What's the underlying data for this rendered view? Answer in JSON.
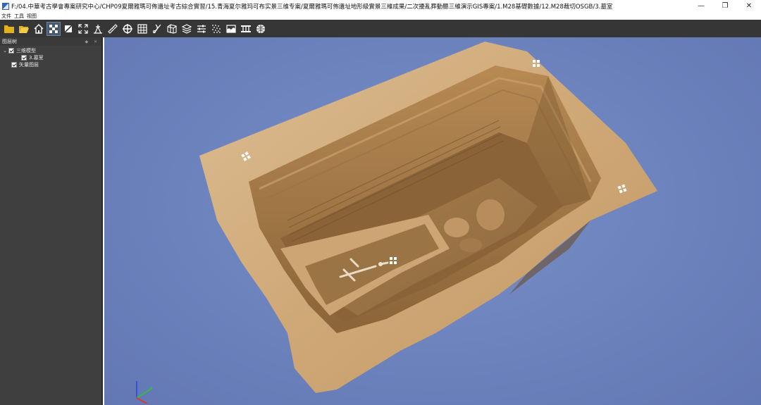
{
  "window": {
    "title": "F:/04.中華考古學會專案研究中心/CHP09夏爾雅瑪可佈遺址考古綜合實習/15.青海夏尔雅玛可布实景三维专案/夏爾雅瑪可佈遺址地形級實景三維成果/二次擾亂葬動聽三維演示GIS專案/1.M28基礎數據/12.M28裁切OSGB/3.墓室",
    "controls": [
      "minimize",
      "restore",
      "close"
    ]
  },
  "menu": [
    {
      "label": "文件"
    },
    {
      "label": "工具"
    },
    {
      "label": "视图"
    }
  ],
  "toolbar": {
    "buttons": [
      {
        "name": "open-folder-icon",
        "color": "#e3b31e"
      },
      {
        "name": "open-file-icon",
        "color": "#e3b31e"
      },
      {
        "name": "home-icon"
      },
      {
        "name": "texture-toggle-icon",
        "active": true
      },
      {
        "name": "wireframe-icon"
      },
      {
        "name": "fullscreen-icon"
      },
      {
        "name": "height-measure-icon"
      },
      {
        "name": "distance-measure-icon"
      },
      {
        "name": "coordinate-pick-icon"
      },
      {
        "name": "area-measure-icon"
      },
      {
        "name": "clip-icon"
      },
      {
        "name": "volume-icon"
      },
      {
        "name": "layers-icon"
      },
      {
        "name": "settings-sliders-icon"
      },
      {
        "name": "point-cloud-icon"
      },
      {
        "name": "profile-icon"
      },
      {
        "name": "elevation-icon"
      },
      {
        "name": "globe-icon"
      }
    ]
  },
  "layer_panel": {
    "title": "图层树",
    "header_tools": "◆ ✕",
    "items": [
      {
        "label": "三维模型",
        "checked": true,
        "expanded": true,
        "level": 0
      },
      {
        "label": "3.墓室",
        "checked": true,
        "level": 1
      },
      {
        "label": "矢量图层",
        "checked": true,
        "level": 0
      }
    ]
  },
  "viewport": {
    "background": "#6c82bd",
    "markers": [
      "marker-top-right",
      "marker-left",
      "marker-right",
      "marker-coffin"
    ]
  },
  "colors": {
    "soil_light": "#d7b487",
    "soil_mid": "#b88a55",
    "soil_dark": "#7a5a36",
    "axis_x": "#e0342a",
    "axis_y": "#2fbf3a",
    "axis_z": "#2b4fe0"
  }
}
